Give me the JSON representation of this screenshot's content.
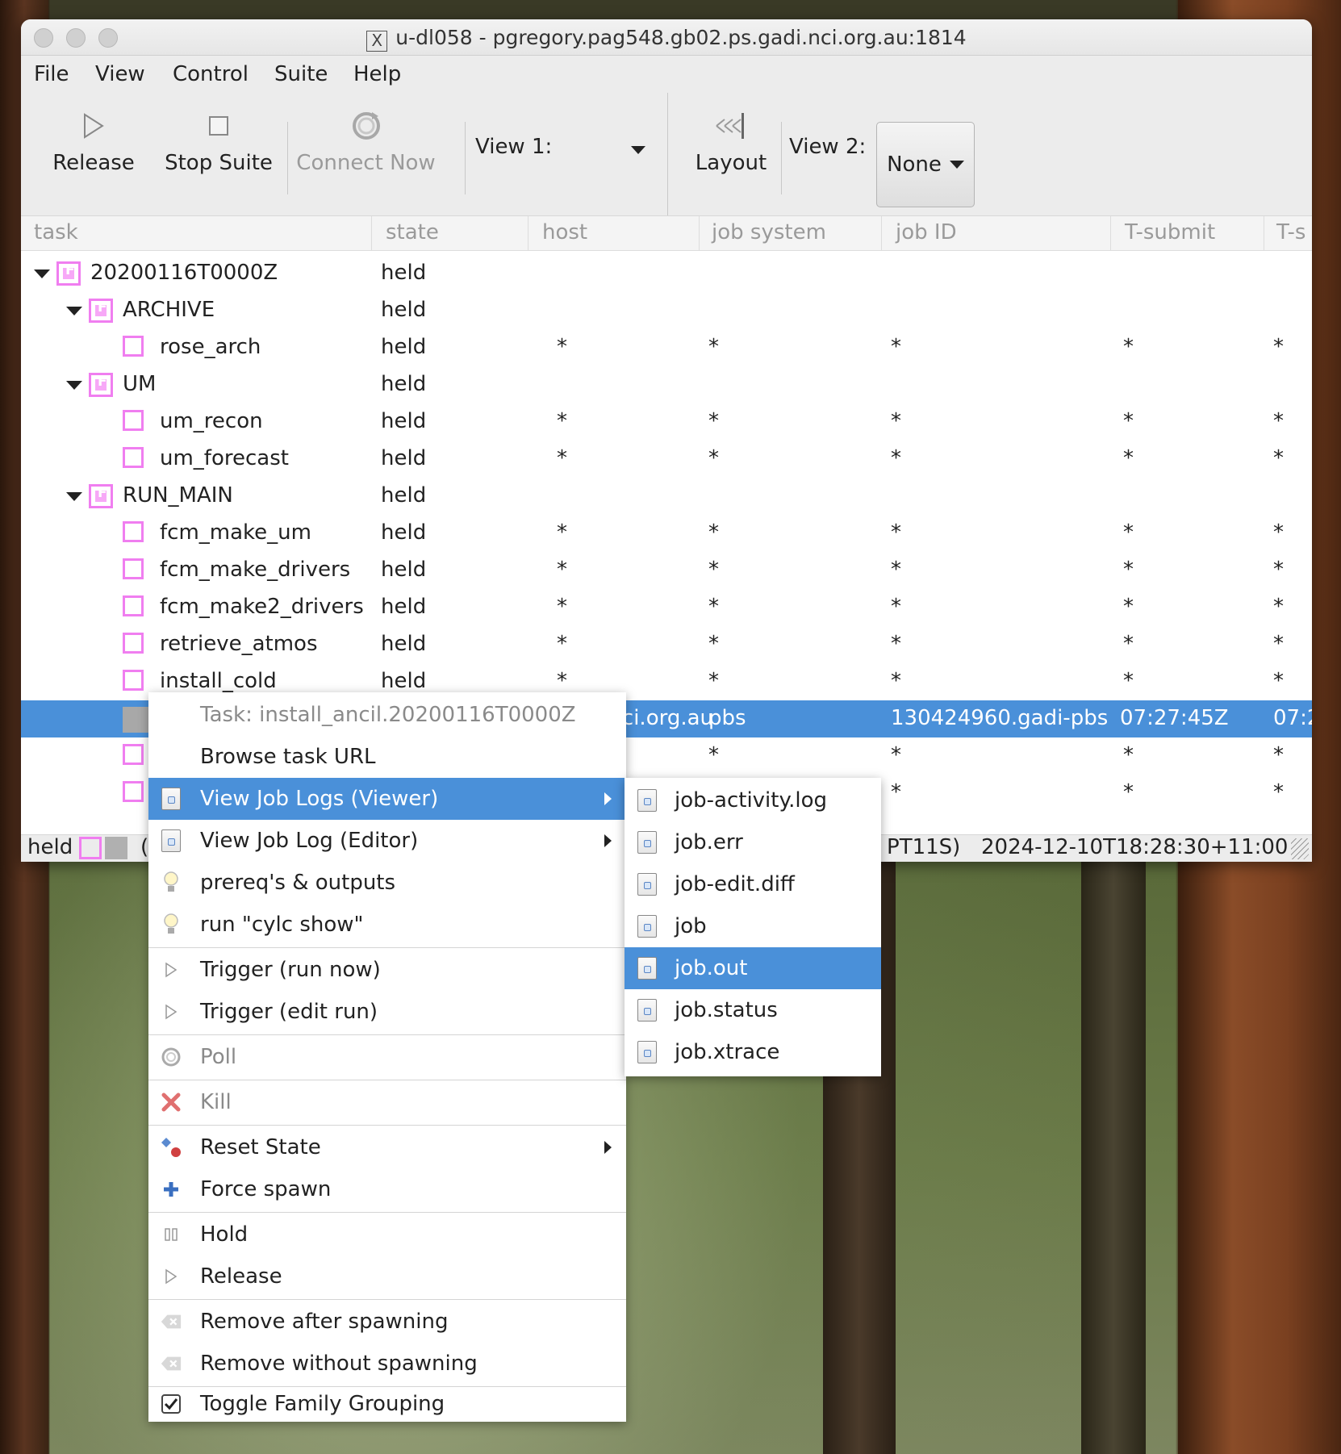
{
  "window": {
    "title": "u-dl058 - pgregory.pag548.gb02.ps.gadi.nci.org.au:1814"
  },
  "menubar": [
    "File",
    "View",
    "Control",
    "Suite",
    "Help"
  ],
  "toolbar": {
    "release": "Release",
    "stop_suite": "Stop Suite",
    "connect_now": "Connect Now",
    "view1_label": "View 1:",
    "layout": "Layout",
    "view2_label": "View 2:",
    "view2_value": "None"
  },
  "table": {
    "columns": [
      "task",
      "state",
      "host",
      "job system",
      "job ID",
      "T-submit",
      "T-s"
    ],
    "rows": [
      {
        "name": "20200116T0000Z",
        "state": "held",
        "host": "",
        "jobsys": "",
        "jobid": "",
        "tsubmit": "",
        "ts": ""
      },
      {
        "name": "ARCHIVE",
        "state": "held",
        "host": "",
        "jobsys": "",
        "jobid": "",
        "tsubmit": "",
        "ts": ""
      },
      {
        "name": "rose_arch",
        "state": "held",
        "host": "*",
        "jobsys": "*",
        "jobid": "*",
        "tsubmit": "*",
        "ts": "*"
      },
      {
        "name": "UM",
        "state": "held",
        "host": "",
        "jobsys": "",
        "jobid": "",
        "tsubmit": "",
        "ts": ""
      },
      {
        "name": "um_recon",
        "state": "held",
        "host": "*",
        "jobsys": "*",
        "jobid": "*",
        "tsubmit": "*",
        "ts": "*"
      },
      {
        "name": "um_forecast",
        "state": "held",
        "host": "*",
        "jobsys": "*",
        "jobid": "*",
        "tsubmit": "*",
        "ts": "*"
      },
      {
        "name": "RUN_MAIN",
        "state": "held",
        "host": "",
        "jobsys": "",
        "jobid": "",
        "tsubmit": "",
        "ts": ""
      },
      {
        "name": "fcm_make_um",
        "state": "held",
        "host": "*",
        "jobsys": "*",
        "jobid": "*",
        "tsubmit": "*",
        "ts": "*"
      },
      {
        "name": "fcm_make_drivers",
        "state": "held",
        "host": "*",
        "jobsys": "*",
        "jobid": "*",
        "tsubmit": "*",
        "ts": "*"
      },
      {
        "name": "fcm_make2_drivers",
        "state": "held",
        "host": "*",
        "jobsys": "*",
        "jobid": "*",
        "tsubmit": "*",
        "ts": "*"
      },
      {
        "name": "retrieve_atmos",
        "state": "held",
        "host": "*",
        "jobsys": "*",
        "jobid": "*",
        "tsubmit": "*",
        "ts": "*"
      },
      {
        "name": "install_cold",
        "state": "held",
        "host": "*",
        "jobsys": "*",
        "jobid": "*",
        "tsubmit": "*",
        "ts": "*"
      },
      {
        "name": "install_ancil",
        "state": "succeeded",
        "host": "gadi.nci.org.au",
        "jobsys": "pbs",
        "jobid": "130424960.gadi-pbs",
        "tsubmit": "07:27:45Z",
        "ts": "07:2"
      },
      {
        "name": "",
        "state": "",
        "host": "",
        "jobsys": "*",
        "jobid": "*",
        "tsubmit": "*",
        "ts": "*"
      },
      {
        "name": "",
        "state": "",
        "host": "",
        "jobsys": "*",
        "jobid": "*",
        "tsubmit": "*",
        "ts": "*"
      }
    ]
  },
  "statusbar": {
    "state": "held",
    "paren": "(",
    "interval": ": PT11S)",
    "timestamp": "2024-12-10T18:28:30+11:00"
  },
  "context_menu": {
    "header": "Task: install_ancil.20200116T0000Z",
    "items": [
      {
        "label": "Browse task URL"
      },
      {
        "label": "View Job Logs (Viewer)"
      },
      {
        "label": "View Job Log (Editor)"
      },
      {
        "label": "prereq's & outputs"
      },
      {
        "label": "run \"cylc show\""
      },
      {
        "label": "Trigger (run now)"
      },
      {
        "label": "Trigger (edit run)"
      },
      {
        "label": "Poll"
      },
      {
        "label": "Kill"
      },
      {
        "label": "Reset State"
      },
      {
        "label": "Force spawn"
      },
      {
        "label": "Hold"
      },
      {
        "label": "Release"
      },
      {
        "label": "Remove after spawning"
      },
      {
        "label": "Remove without spawning"
      },
      {
        "label": "Toggle Family Grouping"
      }
    ]
  },
  "submenu": {
    "items": [
      "job-activity.log",
      "job.err",
      "job-edit.diff",
      "job",
      "job.out",
      "job.status",
      "job.xtrace"
    ],
    "highlighted": "job.out"
  },
  "colors": {
    "selection": "#4a90d9",
    "task_held": "#f07ef0",
    "task_succeeded": "#a8a8a8"
  }
}
